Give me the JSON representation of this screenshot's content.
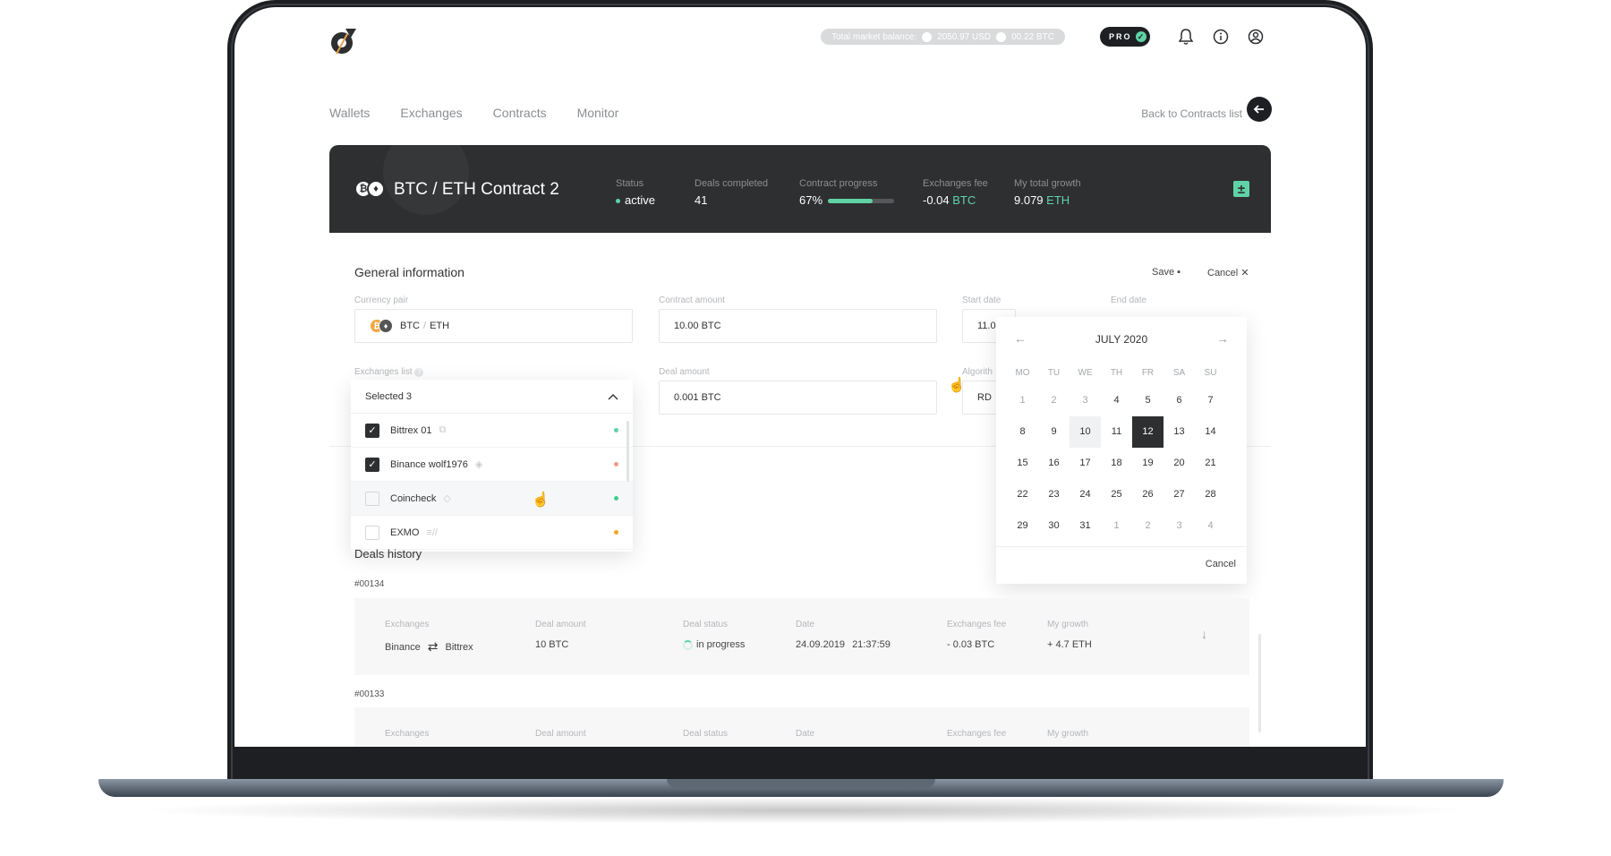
{
  "header": {
    "balance_label": "Total market balance:",
    "balance_usd": "2050.97 USD",
    "balance_btc": "00.22 BTC",
    "pro_label": "PRO"
  },
  "nav": {
    "items": [
      "Wallets",
      "Exchanges",
      "Contracts",
      "Monitor"
    ],
    "back_label": "Back to Contracts list"
  },
  "contract": {
    "title": "BTC / ETH Contract 2",
    "status_label": "Status",
    "status_value": "active",
    "deals_label": "Deals completed",
    "deals_value": "41",
    "progress_label": "Contract progress",
    "progress_value": "67%",
    "progress_fraction": 0.67,
    "fee_label": "Exchanges fee",
    "fee_value": "-0.04",
    "fee_unit": "BTC",
    "growth_label": "My total growth",
    "growth_value": "9.079",
    "growth_unit": "ETH"
  },
  "general": {
    "title": "General information",
    "save_label": "Save",
    "cancel_label": "Cancel",
    "currency_pair_label": "Currency pair",
    "currency_pair_base": "BTC",
    "currency_pair_quote": "ETH",
    "contract_amount_label": "Contract amount",
    "contract_amount_value": "10.00 BTC",
    "start_date_label": "Start date",
    "start_date_value": "11.0",
    "end_date_label": "End date",
    "exchanges_list_label": "Exchanges list",
    "deal_amount_label": "Deal amount",
    "deal_amount_value": "0.001 BTC",
    "algorithm_label": "Algorith",
    "algorithm_value": "RD"
  },
  "exchanges_dropdown": {
    "header": "Selected 3",
    "items": [
      {
        "name": "Bittrex 01",
        "checked": true,
        "status_color": "#5fd3a6"
      },
      {
        "name": "Binance wolf1976",
        "checked": true,
        "status_color": "#ef9a8a"
      },
      {
        "name": "Coincheck",
        "checked": false,
        "status_color": "#3fcf8e"
      },
      {
        "name": "EXMO",
        "checked": false,
        "status_color": "#f5a623"
      }
    ]
  },
  "calendar": {
    "month": "JULY 2020",
    "weekdays": [
      "MO",
      "TU",
      "WE",
      "TH",
      "FR",
      "SA",
      "SU"
    ],
    "days": [
      {
        "d": "1",
        "m": true
      },
      {
        "d": "2",
        "m": true
      },
      {
        "d": "3",
        "m": true
      },
      {
        "d": "4"
      },
      {
        "d": "5"
      },
      {
        "d": "6"
      },
      {
        "d": "7"
      },
      {
        "d": "8"
      },
      {
        "d": "9"
      },
      {
        "d": "10",
        "h": true
      },
      {
        "d": "11"
      },
      {
        "d": "12",
        "s": true
      },
      {
        "d": "13"
      },
      {
        "d": "14"
      },
      {
        "d": "15"
      },
      {
        "d": "16"
      },
      {
        "d": "17"
      },
      {
        "d": "18"
      },
      {
        "d": "19"
      },
      {
        "d": "20"
      },
      {
        "d": "21"
      },
      {
        "d": "22"
      },
      {
        "d": "23"
      },
      {
        "d": "24"
      },
      {
        "d": "25"
      },
      {
        "d": "26"
      },
      {
        "d": "27"
      },
      {
        "d": "28"
      },
      {
        "d": "29"
      },
      {
        "d": "30"
      },
      {
        "d": "31"
      },
      {
        "d": "1",
        "m": true
      },
      {
        "d": "2",
        "m": true
      },
      {
        "d": "3",
        "m": true
      },
      {
        "d": "4",
        "m": true
      }
    ],
    "cancel_label": "Cancel"
  },
  "deals": {
    "title": "Deals history",
    "items": [
      {
        "id": "#00134",
        "exchanges_label": "Exchanges",
        "from": "Binance",
        "to": "Bittrex",
        "amount_label": "Deal amount",
        "amount": "10 BTC",
        "status_label": "Deal status",
        "status": "in progress",
        "date_label": "Date",
        "date": "24.09.2019",
        "time": "21:37:59",
        "fee_label": "Exchanges fee",
        "fee": "- 0.03 BTC",
        "growth_label": "My growth",
        "growth": "+ 4.7 ETH"
      },
      {
        "id": "#00133",
        "exchanges_label": "Exchanges",
        "amount_label": "Deal amount",
        "status_label": "Deal status",
        "date_label": "Date",
        "fee_label": "Exchanges fee",
        "growth_label": "My growth"
      }
    ]
  },
  "colors": {
    "accent": "#5fd3a6",
    "dark": "#2e2f31",
    "negative": "#ef7d6a"
  }
}
